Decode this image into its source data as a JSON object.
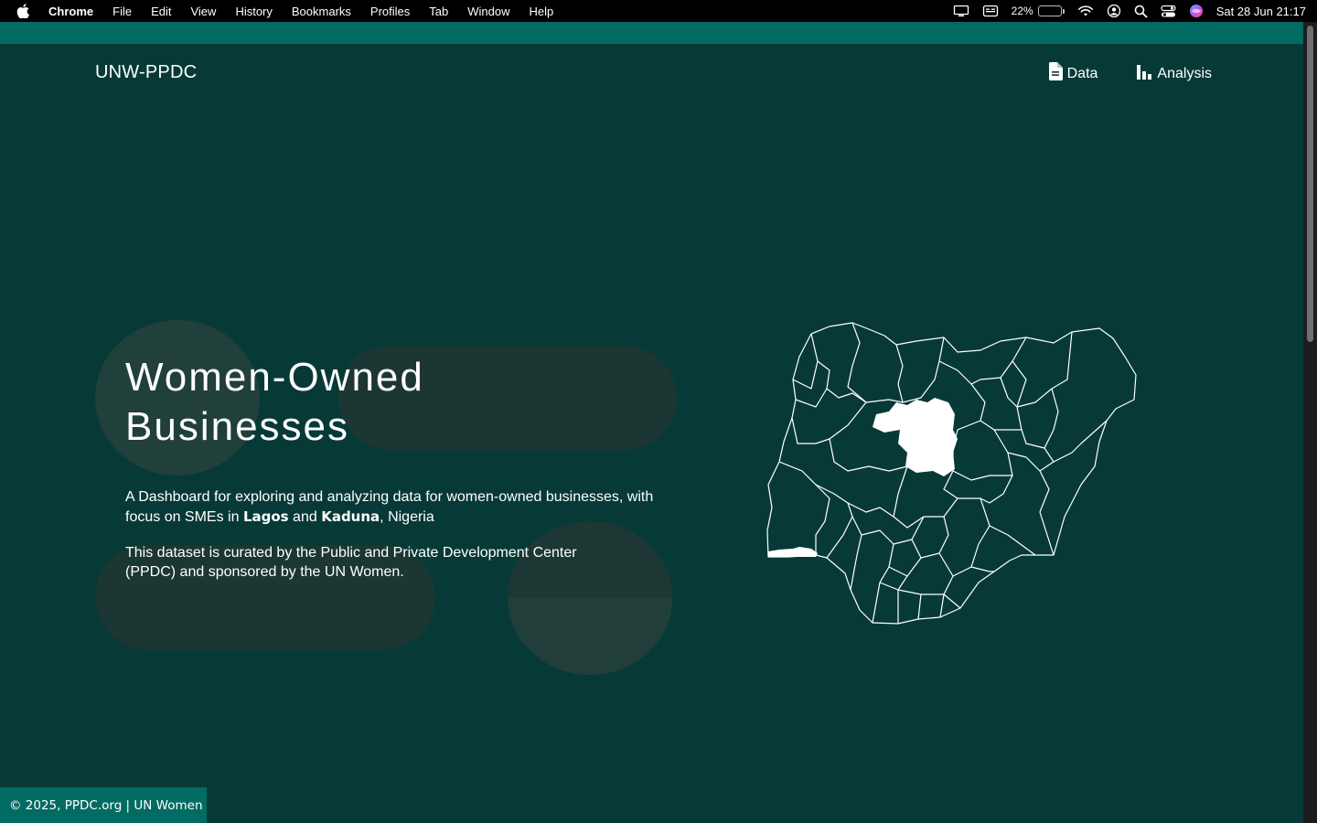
{
  "menubar": {
    "app_name": "Chrome",
    "items": [
      "File",
      "Edit",
      "View",
      "History",
      "Bookmarks",
      "Profiles",
      "Tab",
      "Window",
      "Help"
    ],
    "battery_percent": "22%",
    "battery_level": 0.22,
    "clock": "Sat 28 Jun  21:17"
  },
  "header": {
    "brand": "UNW-PPDC",
    "nav": [
      {
        "label": "Data",
        "icon": "document-icon"
      },
      {
        "label": "Analysis",
        "icon": "bar-chart-icon"
      }
    ]
  },
  "hero": {
    "title_line1": "Women-Owned",
    "title_line2": "Businesses",
    "desc_part1": "A Dashboard for exploring and analyzing data for women-owned businesses, with focus on SMEs in ",
    "desc_city1": "Lagos",
    "desc_and": " and ",
    "desc_city2": "Kaduna",
    "desc_end": ", Nigeria",
    "note": "This dataset is curated by the Public and Private Development Center (PPDC) and sponsored by the UN Women."
  },
  "map": {
    "highlighted_states": [
      "Kaduna",
      "Lagos"
    ],
    "highlight_color": "#ffffff",
    "outline_color": "#ffffff"
  },
  "footer": {
    "text": "© 2025, PPDC.org | UN Women"
  },
  "colors": {
    "background": "#073a36",
    "accent": "#026b63"
  }
}
